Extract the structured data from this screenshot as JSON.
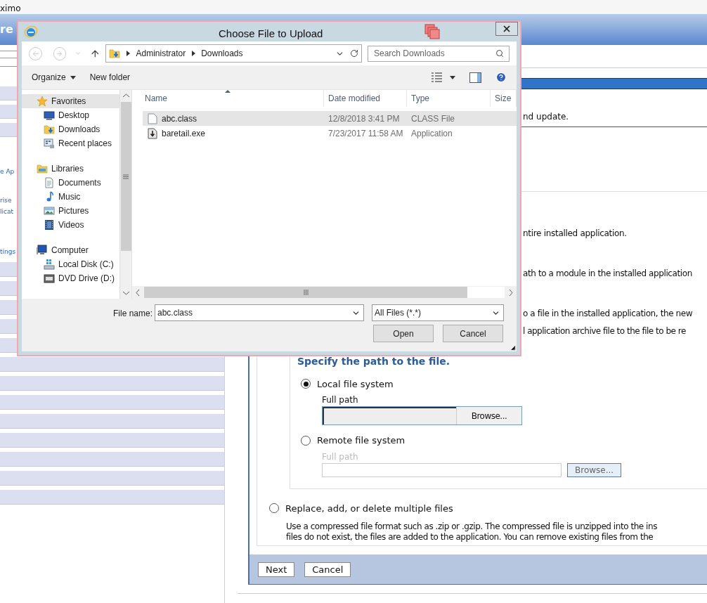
{
  "page": {
    "top_text": "ximo",
    "header_text": "re",
    "sidebar_links": [
      "e Ap",
      "rise",
      "licat",
      "tings"
    ],
    "fragments": [
      "nd update.",
      "ntire installed application.",
      "ath to a module in the installed application",
      "o a file in the installed application, the new",
      "l application archive file to the file to be re"
    ],
    "section_heading": "Specify the path to the file.",
    "sources": [
      {
        "label": "Local file system",
        "selected": true,
        "field_label": "Full path",
        "button": "Browse...",
        "disabled": false
      },
      {
        "label": "Remote file system",
        "selected": false,
        "field_label": "Full path",
        "button": "Browse...",
        "disabled": true
      }
    ],
    "multi": {
      "label": "Replace, add, or delete multiple files",
      "selected": false,
      "lines": [
        "Use a compressed file format such as .zip or .gzip. The compressed file is unzipped into the ins",
        "files do not exist, the files are added to the application. You can remove existing files from the"
      ]
    },
    "buttons": [
      "Next",
      "Cancel"
    ]
  },
  "dialog": {
    "title": "Choose File to Upload",
    "address": [
      "Administrator",
      "Downloads"
    ],
    "search_placeholder": "Search Downloads",
    "toolbar": [
      "Organize",
      "New folder"
    ],
    "nav": [
      {
        "label": "Favorites",
        "kind": "favorites",
        "selected": true,
        "children": [
          {
            "label": "Desktop",
            "kind": "desktop",
            "selected": false
          },
          {
            "label": "Downloads",
            "kind": "downloads",
            "selected": false
          },
          {
            "label": "Recent places",
            "kind": "recent",
            "selected": false
          }
        ]
      },
      {
        "label": "Libraries",
        "kind": "libraries",
        "selected": false,
        "children": [
          {
            "label": "Documents",
            "kind": "documents",
            "selected": false
          },
          {
            "label": "Music",
            "kind": "music",
            "selected": false
          },
          {
            "label": "Pictures",
            "kind": "pictures",
            "selected": false
          },
          {
            "label": "Videos",
            "kind": "videos",
            "selected": false
          }
        ]
      },
      {
        "label": "Computer",
        "kind": "computer",
        "selected": false,
        "children": [
          {
            "label": "Local Disk (C:)",
            "kind": "disk",
            "selected": false
          },
          {
            "label": "DVD Drive (D:)",
            "kind": "dvd",
            "selected": false
          }
        ]
      }
    ],
    "columns": [
      {
        "label": "Name",
        "sorted": true
      },
      {
        "label": "Date modified",
        "sorted": false
      },
      {
        "label": "Type",
        "sorted": false
      },
      {
        "label": "Size",
        "sorted": false
      }
    ],
    "files": [
      {
        "name": "abc.class",
        "date": "12/8/2018 3:41 PM",
        "type": "CLASS File",
        "kind": "class",
        "selected": true
      },
      {
        "name": "baretail.exe",
        "date": "7/23/2017 11:58 AM",
        "type": "Application",
        "kind": "exe",
        "selected": false
      }
    ],
    "file_name_label": "File name:",
    "file_name": "abc.class",
    "filter": "All Files (*.*)",
    "buttons": [
      "Open",
      "Cancel"
    ]
  }
}
